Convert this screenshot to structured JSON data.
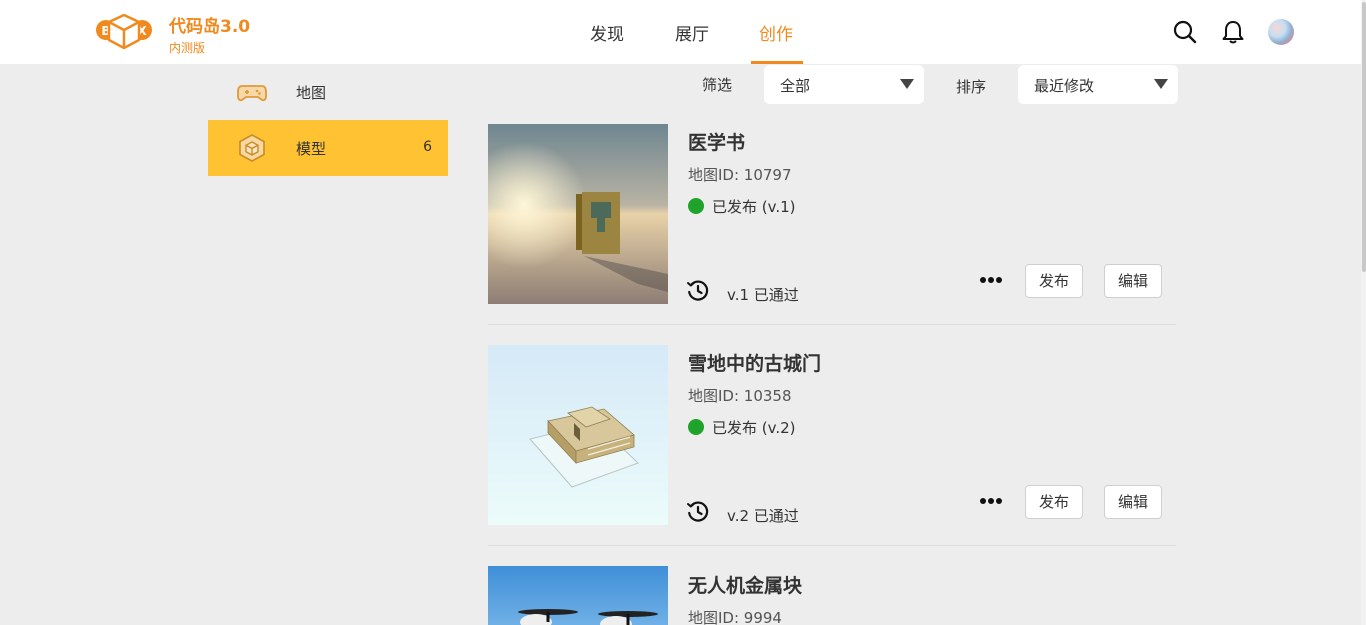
{
  "brand": {
    "title": "代码岛3.0",
    "subtitle": "内测版"
  },
  "nav": {
    "items": [
      {
        "label": "发现"
      },
      {
        "label": "展厅"
      },
      {
        "label": "创作"
      }
    ],
    "active": "创作"
  },
  "header_icons": [
    "search-icon",
    "bell-icon",
    "avatar"
  ],
  "sidebar": {
    "items": [
      {
        "label": "地图",
        "icon": "gamepad-icon",
        "count": ""
      },
      {
        "label": "模型",
        "icon": "cube-icon",
        "count": "6"
      }
    ]
  },
  "filter": {
    "label": "筛选",
    "value": "全部"
  },
  "sort": {
    "label": "排序",
    "value": "最近修改"
  },
  "cards": [
    {
      "title": "医学书",
      "id_text": "地图ID: 10797",
      "status": "已发布 (v.1)",
      "review": "v.1 已通过",
      "publish": "发布",
      "edit": "编辑"
    },
    {
      "title": "雪地中的古城门",
      "id_text": "地图ID: 10358",
      "status": "已发布 (v.2)",
      "review": "v.2 已通过",
      "publish": "发布",
      "edit": "编辑"
    },
    {
      "title": "无人机金属块",
      "id_text": "地图ID: 9994"
    }
  ],
  "colors": {
    "accent": "#f08a1e",
    "sidebar_active": "#ffc233",
    "status_published": "#1fa32a",
    "background": "#ededed"
  }
}
